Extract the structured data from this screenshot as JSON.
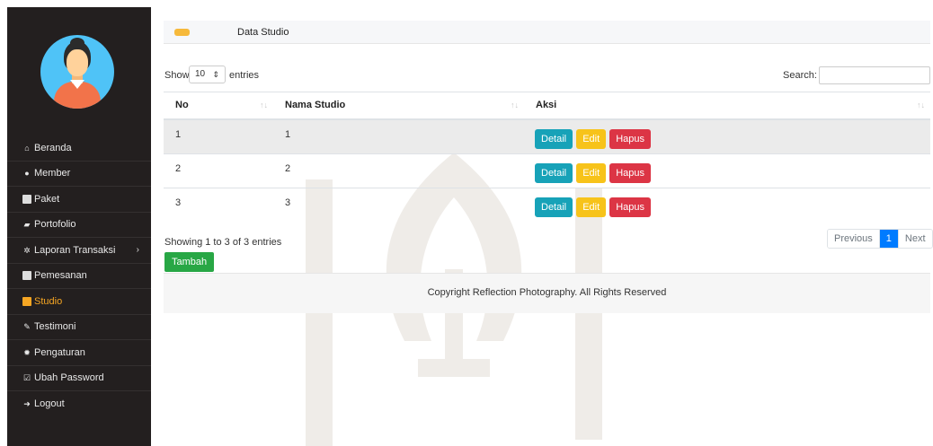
{
  "sidebar": {
    "items": [
      {
        "label": "Beranda",
        "icon": "home-icon"
      },
      {
        "label": "Member",
        "icon": "user-icon"
      },
      {
        "label": "Paket",
        "icon": "image-icon"
      },
      {
        "label": "Portofolio",
        "icon": "book-icon"
      },
      {
        "label": "Laporan Transaksi",
        "icon": "gear-icon",
        "chevron": "›"
      },
      {
        "label": "Pemesanan",
        "icon": "calendar-icon"
      },
      {
        "label": "Studio",
        "icon": "studio-icon",
        "active": true
      },
      {
        "label": "Testimoni",
        "icon": "pencil-icon"
      },
      {
        "label": "Pengaturan",
        "icon": "settings-icon"
      },
      {
        "label": "Ubah Password",
        "icon": "edit-icon"
      },
      {
        "label": "Logout",
        "icon": "logout-icon"
      }
    ]
  },
  "header": {
    "title": "Data Studio"
  },
  "table_controls": {
    "show_label": "Show",
    "length_value": "10",
    "entries_label": "entries",
    "search_label": "Search:",
    "search_value": ""
  },
  "table": {
    "columns": [
      "No",
      "Nama Studio",
      "Aksi"
    ],
    "sort_icon": "↑↓",
    "rows": [
      {
        "no": "1",
        "nama": "1"
      },
      {
        "no": "2",
        "nama": "2"
      },
      {
        "no": "3",
        "nama": "3"
      }
    ],
    "actions": {
      "detail": "Detail",
      "edit": "Edit",
      "hapus": "Hapus"
    }
  },
  "info": "Showing 1 to 3 of 3 entries",
  "add_button": "Tambah",
  "pagination": {
    "previous": "Previous",
    "current": "1",
    "next": "Next"
  },
  "footer": "Copyright Reflection Photography. All Rights Reserved",
  "colors": {
    "sidebar_bg": "#231f1f",
    "accent": "#f6a623",
    "detail": "#17a2b8",
    "edit": "#f7c31a",
    "hapus": "#dc3545",
    "tambah": "#28a745",
    "pager_active": "#007bff"
  }
}
